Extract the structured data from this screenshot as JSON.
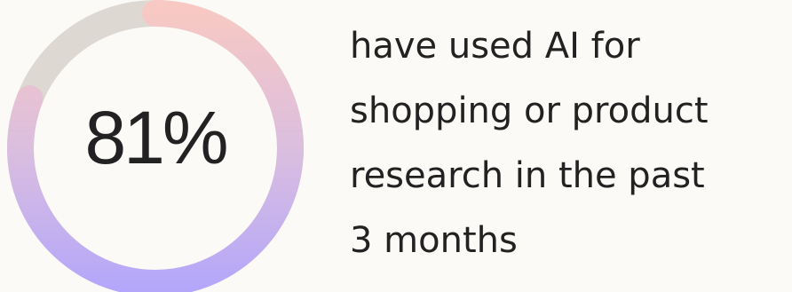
{
  "chart_data": {
    "type": "pie",
    "value": 81,
    "max": 100,
    "label": "81%",
    "colors": {
      "track": "#ddd8d2",
      "gradient_start": "#f8c9c3",
      "gradient_mid": "#d9bde0",
      "gradient_end": "#b3a6fb"
    }
  },
  "stat": {
    "caption_lines": [
      "have used AI for",
      "shopping or product",
      "research in the past",
      "3 months"
    ]
  }
}
